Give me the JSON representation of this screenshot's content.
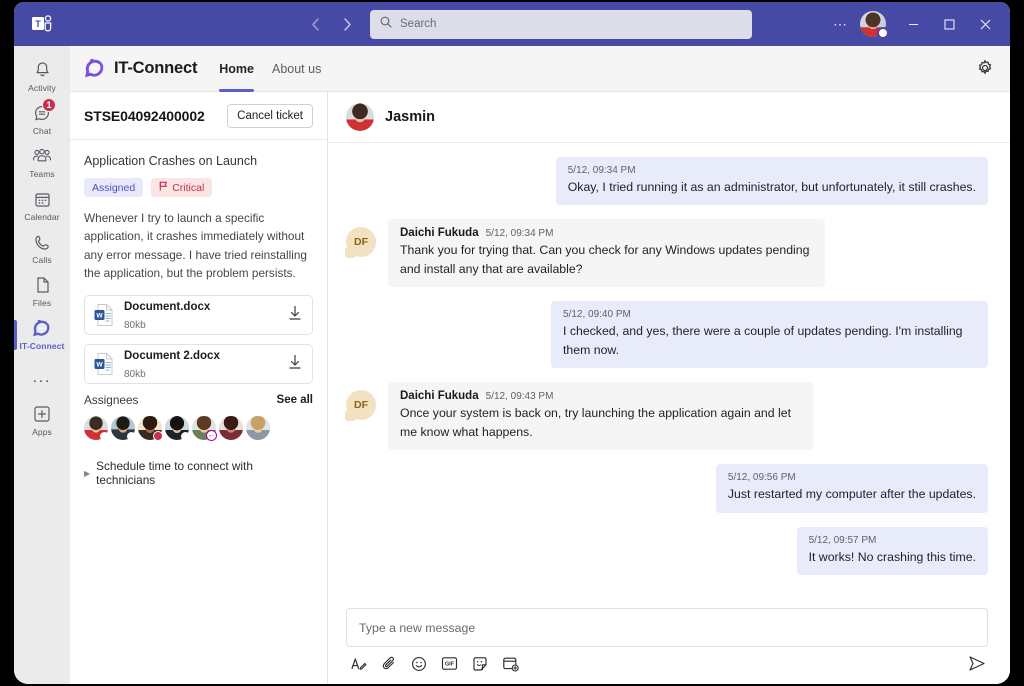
{
  "titlebar": {
    "logo_icon": "teams-logo-icon",
    "back_icon": "chevron-left-icon",
    "forward_icon": "chevron-right-icon",
    "search": {
      "placeholder": "Search",
      "value": "",
      "icon": "search-icon"
    },
    "more_icon": "ellipsis-icon",
    "avatar_icon": "user-avatar",
    "minimize_icon": "minimize-icon",
    "maximize_icon": "maximize-icon",
    "close_icon": "close-icon",
    "bg_color": "#464aa5"
  },
  "rail": {
    "items": [
      {
        "label": "Activity",
        "icon": "bell-icon",
        "badge": ""
      },
      {
        "label": "Chat",
        "icon": "chat-icon",
        "badge": "1"
      },
      {
        "label": "Teams",
        "icon": "teams-people-icon",
        "badge": ""
      },
      {
        "label": "Calendar",
        "icon": "calendar-icon",
        "badge": ""
      },
      {
        "label": "Calls",
        "icon": "phone-icon",
        "badge": ""
      },
      {
        "label": "Files",
        "icon": "file-icon",
        "badge": ""
      },
      {
        "label": "IT-Connect",
        "icon": "it-connect-icon",
        "badge": ""
      }
    ],
    "more_label": "...",
    "apps": {
      "label": "Apps",
      "icon": "plus-box-icon"
    },
    "active_item": "IT-Connect",
    "active_color": "#5b5fc7",
    "badge_color": "#c4314b"
  },
  "app_header": {
    "logo_icon": "it-connect-logo",
    "title": "IT-Connect",
    "tabs": [
      {
        "label": "Home",
        "active": true
      },
      {
        "label": "About us",
        "active": false
      }
    ],
    "settings_icon": "gear-icon"
  },
  "ticket": {
    "id": "STSE04092400002",
    "cancel_label": "Cancel ticket",
    "title": "Application Crashes on Launch",
    "status_chip": {
      "label": "Assigned",
      "color": "#4b51c4",
      "bg": "#e9e9fb"
    },
    "priority_chip": {
      "label": "Critical",
      "color": "#c4314b",
      "bg": "#fbe4e4",
      "icon": "flag-icon"
    },
    "description": "Whenever I try to launch a specific application, it crashes immediately without any error message. I have tried reinstalling the application, but the problem persists.",
    "attachments": [
      {
        "name": "Document.docx",
        "size": "80kb",
        "icon": "word-doc-icon",
        "download_icon": "download-icon"
      },
      {
        "name": "Document 2.docx",
        "size": "80kb",
        "icon": "word-doc-icon",
        "download_icon": "download-icon"
      }
    ],
    "assignees_label": "Assignees",
    "see_all_label": "See all",
    "assignee_count": 7,
    "schedule_label": "Schedule time to connect with technicians",
    "schedule_caret_icon": "chevron-right-small-icon"
  },
  "chat": {
    "header": {
      "name": "Jasmin",
      "avatar_icon": "jasmin-avatar"
    },
    "messages": [
      {
        "direction": "out",
        "sender": "",
        "time": "5/12, 09:34 PM",
        "text": "Okay, I tried running it as an administrator, but unfortunately, it still crashes."
      },
      {
        "direction": "in",
        "sender": "Daichi Fukuda",
        "initials": "DF",
        "time": "5/12, 09:34 PM",
        "text": "Thank you for trying that. Can you check for any Windows updates pending and install any that are available?"
      },
      {
        "direction": "out",
        "sender": "",
        "time": "5/12, 09:40 PM",
        "text": "I checked, and yes, there were a couple of updates pending. I'm installing them now."
      },
      {
        "direction": "in",
        "sender": "Daichi Fukuda",
        "initials": "DF",
        "time": "5/12, 09:43 PM",
        "text": "Once your system is back on, try launching the application again and let me know what happens."
      },
      {
        "direction": "out",
        "sender": "",
        "time": "5/12, 09:56 PM",
        "text": "Just restarted my computer after the updates."
      },
      {
        "direction": "out",
        "sender": "",
        "time": "5/12, 09:57 PM",
        "text": "It works! No crashing this time."
      }
    ],
    "bubble_in_bg": "#f5f5f5",
    "bubble_out_bg": "#e8ebfa"
  },
  "composer": {
    "placeholder": "Type a new message",
    "value": "",
    "tools": [
      {
        "name": "format-icon",
        "label": "Format"
      },
      {
        "name": "attach-icon",
        "label": "Attach"
      },
      {
        "name": "emoji-icon",
        "label": "Emoji"
      },
      {
        "name": "giphy-icon",
        "label": "GIF"
      },
      {
        "name": "sticker-icon",
        "label": "Sticker"
      },
      {
        "name": "apps-message-icon",
        "label": "More apps"
      }
    ],
    "send_icon": "send-icon"
  }
}
